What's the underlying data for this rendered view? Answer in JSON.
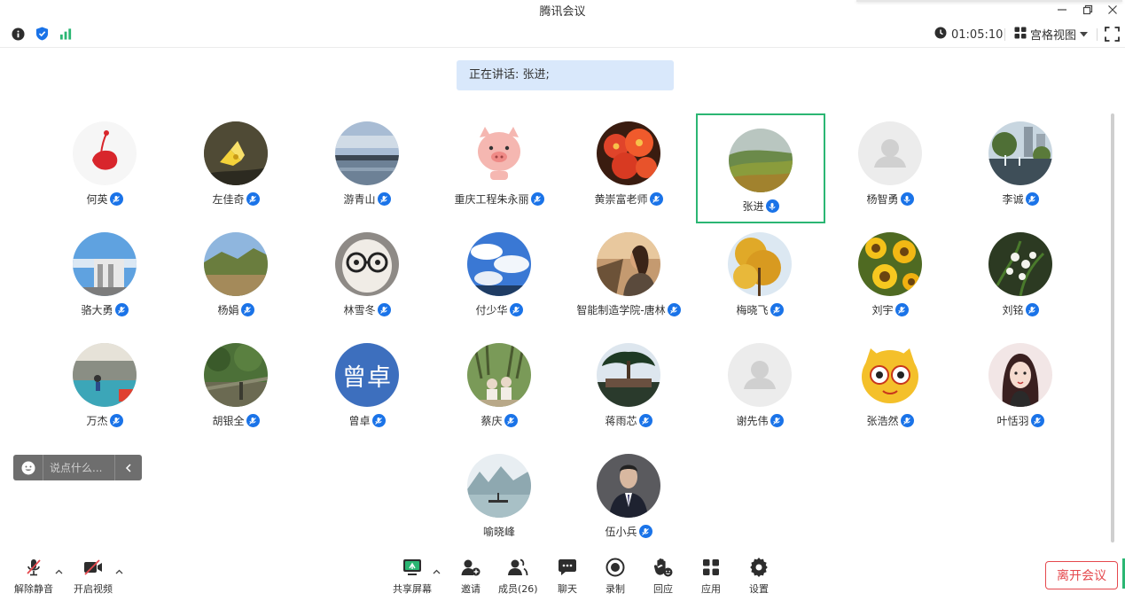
{
  "window": {
    "title": "腾讯会议",
    "controls": [
      "minimize-icon",
      "restore-icon",
      "close-icon"
    ]
  },
  "infobar": {
    "timer": "01:05:10",
    "view_mode": "宫格视图",
    "icons": [
      "info-icon",
      "shield-icon",
      "signal-icon",
      "clock-icon",
      "grid-view-icon",
      "fullscreen-icon"
    ]
  },
  "speaker_banner": "正在讲话: 张进;",
  "participants": [
    {
      "name": "何英"
    },
    {
      "name": "左佳奇"
    },
    {
      "name": "游青山"
    },
    {
      "name": "重庆工程朱永丽"
    },
    {
      "name": "黄崇富老师"
    },
    {
      "name": "张进"
    },
    {
      "name": "杨智勇"
    },
    {
      "name": "李诚"
    },
    {
      "name": "骆大勇"
    },
    {
      "name": "杨娟"
    },
    {
      "name": "林雪冬"
    },
    {
      "name": "付少华"
    },
    {
      "name": "智能制造学院-唐林"
    },
    {
      "name": "梅晓飞"
    },
    {
      "name": "刘宇"
    },
    {
      "name": "刘铭"
    },
    {
      "name": "万杰"
    },
    {
      "name": "胡银全"
    },
    {
      "name": "曾卓",
      "avatar_text": "曾卓"
    },
    {
      "name": "蔡庆"
    },
    {
      "name": "蒋雨芯"
    },
    {
      "name": "谢先伟"
    },
    {
      "name": "张浩然"
    },
    {
      "name": "叶恬羽"
    },
    {
      "name": "喻晓峰"
    },
    {
      "name": "伍小兵"
    }
  ],
  "chat": {
    "placeholder": "说点什么..."
  },
  "toolbar": {
    "unmute": "解除静音",
    "start_video": "开启视频",
    "share_screen": "共享屏幕",
    "invite": "邀请",
    "members": "成员(26)",
    "chat": "聊天",
    "record": "录制",
    "reactions": "回应",
    "apps": "应用",
    "settings": "设置",
    "leave": "离开会议"
  },
  "colors": {
    "accent_blue": "#1a73e8",
    "active_speaker_border": "#2bb673",
    "leave_red": "#e5484d",
    "banner_bg": "#d9e8fb"
  }
}
